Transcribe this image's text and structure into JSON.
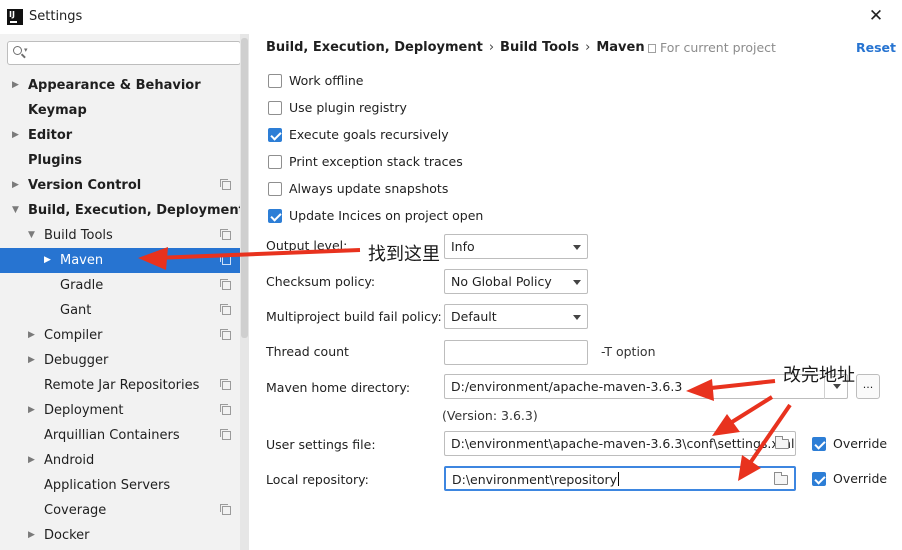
{
  "window": {
    "title": "Settings",
    "app_icon_text": "IJ"
  },
  "sidebar": {
    "search_placeholder": "",
    "items": [
      {
        "label": "Appearance & Behavior",
        "bold": true,
        "arrow": "right",
        "indent": 0,
        "copy_icon": false
      },
      {
        "label": "Keymap",
        "bold": true,
        "arrow": "",
        "indent": 0,
        "copy_icon": false
      },
      {
        "label": "Editor",
        "bold": true,
        "arrow": "right",
        "indent": 0,
        "copy_icon": false
      },
      {
        "label": "Plugins",
        "bold": true,
        "arrow": "",
        "indent": 0,
        "copy_icon": false
      },
      {
        "label": "Version Control",
        "bold": true,
        "arrow": "right",
        "indent": 0,
        "copy_icon": true
      },
      {
        "label": "Build, Execution, Deployment",
        "bold": true,
        "arrow": "down",
        "indent": 0,
        "copy_icon": false
      },
      {
        "label": "Build Tools",
        "bold": false,
        "arrow": "down",
        "indent": 1,
        "copy_icon": true
      },
      {
        "label": "Maven",
        "bold": false,
        "arrow": "right",
        "indent": 2,
        "copy_icon": true,
        "selected": true
      },
      {
        "label": "Gradle",
        "bold": false,
        "arrow": "",
        "indent": 2,
        "copy_icon": true
      },
      {
        "label": "Gant",
        "bold": false,
        "arrow": "",
        "indent": 2,
        "copy_icon": true
      },
      {
        "label": "Compiler",
        "bold": false,
        "arrow": "right",
        "indent": 1,
        "copy_icon": true
      },
      {
        "label": "Debugger",
        "bold": false,
        "arrow": "right",
        "indent": 1,
        "copy_icon": false
      },
      {
        "label": "Remote Jar Repositories",
        "bold": false,
        "arrow": "",
        "indent": 1,
        "copy_icon": true
      },
      {
        "label": "Deployment",
        "bold": false,
        "arrow": "right",
        "indent": 1,
        "copy_icon": true
      },
      {
        "label": "Arquillian Containers",
        "bold": false,
        "arrow": "",
        "indent": 1,
        "copy_icon": true
      },
      {
        "label": "Android",
        "bold": false,
        "arrow": "right",
        "indent": 1,
        "copy_icon": false
      },
      {
        "label": "Application Servers",
        "bold": false,
        "arrow": "",
        "indent": 1,
        "copy_icon": false
      },
      {
        "label": "Coverage",
        "bold": false,
        "arrow": "",
        "indent": 1,
        "copy_icon": true
      },
      {
        "label": "Docker",
        "bold": false,
        "arrow": "right",
        "indent": 1,
        "copy_icon": false
      }
    ]
  },
  "header": {
    "breadcrumb": [
      "Build, Execution, Deployment",
      "Build Tools",
      "Maven"
    ],
    "breadcrumb_separator": "›",
    "for_project": "For current project",
    "reset": "Reset"
  },
  "checkboxes": [
    {
      "label": "Work offline",
      "checked": false
    },
    {
      "label": "Use plugin registry",
      "checked": false
    },
    {
      "label": "Execute goals recursively",
      "checked": true
    },
    {
      "label": "Print exception stack traces",
      "checked": false
    },
    {
      "label": "Always update snapshots",
      "checked": false
    },
    {
      "label": "Update Incices on project open",
      "checked": true
    }
  ],
  "form": {
    "output_level": {
      "label": "Output level:",
      "value": "Info"
    },
    "checksum_policy": {
      "label": "Checksum policy:",
      "value": "No Global Policy"
    },
    "multiproject_fail": {
      "label": "Multiproject build fail policy:",
      "value": "Default"
    },
    "thread_count": {
      "label": "Thread count",
      "value": "",
      "suffix": "-T option"
    },
    "maven_home": {
      "label": "Maven home directory:",
      "value": "D:/environment/apache-maven-3.6.3",
      "version": "(Version: 3.6.3)",
      "browse": "..."
    },
    "user_settings": {
      "label": "User settings file:",
      "value": "D:\\environment\\apache-maven-3.6.3\\conf\\settings.xml",
      "override_label": "Override",
      "override_checked": true
    },
    "local_repo": {
      "label": "Local repository:",
      "value": "D:\\environment\\repository",
      "override_label": "Override",
      "override_checked": true
    }
  },
  "annotations": {
    "find_here": "找到这里",
    "change_address": "改完地址"
  },
  "colors": {
    "accent": "#2774d1",
    "arrow_red": "#e8321e",
    "checkbox_blue": "#2d7ed6"
  }
}
